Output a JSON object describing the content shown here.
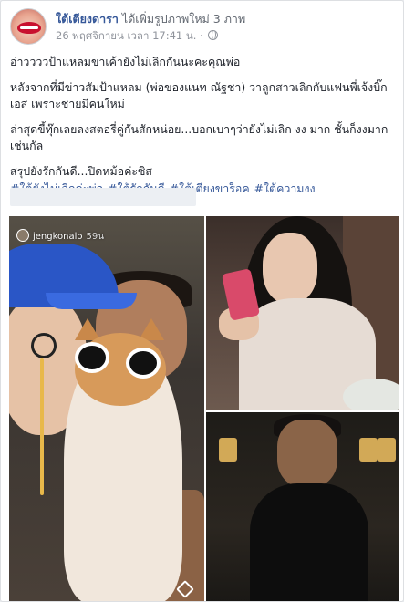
{
  "post": {
    "page_name": "ใต้เตียงดารา",
    "action_text": "ได้เพิ่มรูปภาพใหม่ 3 ภาพ",
    "timestamp": "26 พฤศจิกายน เวลา 17:41 น. ·",
    "privacy_icon": "globe-icon",
    "paragraphs": [
      "อ่าววววป้าแหลมขาเค้ายังไม่เลิกกันนะคะคุณพ่อ",
      "หลังจากที่มีข่าวสัมป้าแหลม (พ่อของแนท ณัฐชา) ว่าลูกสาวเลิกกับแฟนพี่เจ้งบิ๊กเอส เพราะชายมีคนใหม่",
      "ล่าสุดขี้ทุ๊กเลยลงสตอรี่คู่กันสักหน่อย...บอกเบาๆว่ายังไม่เลิก งง มาก ชั้นก็งงมากเช่นกัล",
      "สรุปยังรักกันดี...ปิดหม้อค่ะซิส"
    ],
    "hashtags": [
      "#ใต้ยังไม่เลิกค่ะพ่อ",
      "#ใต้รักกันดี",
      "#ใต้เตียงขาร็อค",
      "#ใต้ความงง"
    ]
  },
  "photos": {
    "story_username": "jengkonalo",
    "story_time": "59น",
    "count": 3
  },
  "colors": {
    "link": "#365899",
    "text": "#1d2129",
    "meta": "#90949c",
    "accent_cap": "#2a56c6"
  }
}
